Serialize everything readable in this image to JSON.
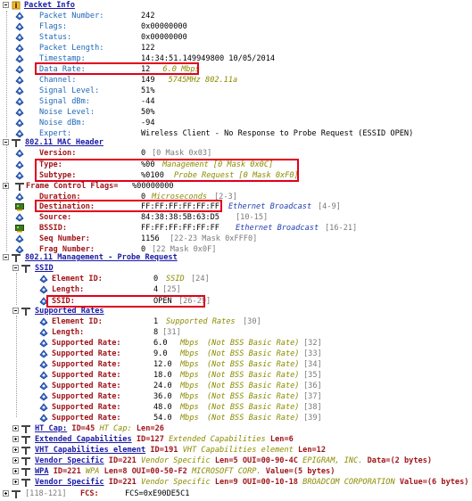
{
  "packet_info": {
    "title": "Packet Info",
    "fields": [
      {
        "label": "Packet Number:",
        "value": "242"
      },
      {
        "label": "Flags:",
        "value": "0x00000000"
      },
      {
        "label": "Status:",
        "value": "0x00000000"
      },
      {
        "label": "Packet Length:",
        "value": "122"
      },
      {
        "label": "Timestamp:",
        "value": "14:34:51.149949800 10/05/2014"
      },
      {
        "label": "Data Rate:",
        "value": "12",
        "extra": "6.0 Mbps"
      },
      {
        "label": "Channel:",
        "value": "149",
        "extra": "5745MHz  802.11a"
      },
      {
        "label": "Signal Level:",
        "value": "51%"
      },
      {
        "label": "Signal dBm:",
        "value": "-44"
      },
      {
        "label": "Noise Level:",
        "value": "50%"
      },
      {
        "label": "Noise dBm:",
        "value": "-94"
      },
      {
        "label": "Expert:",
        "value": "Wireless Client - No Response to Probe Request (ESSID OPEN)"
      }
    ]
  },
  "mac_header": {
    "title": "802.11 MAC Header",
    "version": {
      "label": "Version:",
      "value": "0",
      "extra": "[0 Mask 0x03]"
    },
    "type": {
      "label": "Type:",
      "value": "%00",
      "extra": "Management [0 Mask 0x0C]"
    },
    "subtype": {
      "label": "Subtype:",
      "value": "%0100",
      "extra": "Probe Request [0 Mask 0xF0]"
    },
    "fcf": {
      "label": "Frame Control Flags=",
      "value": "%00000000"
    },
    "duration": {
      "label": "Duration:",
      "value": "0",
      "extra": "Microseconds",
      "range": "[2-3]"
    },
    "destination": {
      "label": "Destination:",
      "value": "FF:FF:FF:FF:FF:FF",
      "extra": "Ethernet Broadcast",
      "range": "[4-9]"
    },
    "source": {
      "label": "Source:",
      "value": "84:38:38:5B:63:D5",
      "range": "[10-15]"
    },
    "bssid": {
      "label": "BSSID:",
      "value": "FF:FF:FF:FF:FF:FF",
      "extra": "Ethernet Broadcast",
      "range": "[16-21]"
    },
    "seq": {
      "label": "Seq Number:",
      "value": "1156",
      "extra": "[22-23 Mask 0xFFF0]"
    },
    "frag": {
      "label": "Frag Number:",
      "value": "0",
      "extra": "[22 Mask 0x0F]"
    }
  },
  "mgmt": {
    "title": "802.11 Management - Probe Request",
    "ssid": {
      "title": "SSID",
      "element_id": {
        "label": "Element ID:",
        "value": "0",
        "extra": "SSID",
        "range": "[24]"
      },
      "length": {
        "label": "Length:",
        "value": "4",
        "range": "[25]"
      },
      "ssid": {
        "label": "SSID:",
        "value": "OPEN",
        "range": "[26-29]"
      }
    },
    "rates": {
      "title": "Supported Rates",
      "element_id": {
        "label": "Element ID:",
        "value": "1",
        "extra": "Supported Rates",
        "range": "[30]"
      },
      "length": {
        "label": "Length:",
        "value": "8",
        "range": "[31]"
      },
      "items": [
        {
          "label": "Supported Rate:",
          "value": "6.0",
          "unit": "Mbps",
          "note": "(Not BSS Basic Rate)",
          "range": "[32]"
        },
        {
          "label": "Supported Rate:",
          "value": "9.0",
          "unit": "Mbps",
          "note": "(Not BSS Basic Rate)",
          "range": "[33]"
        },
        {
          "label": "Supported Rate:",
          "value": "12.0",
          "unit": "Mbps",
          "note": "(Not BSS Basic Rate)",
          "range": "[34]"
        },
        {
          "label": "Supported Rate:",
          "value": "18.0",
          "unit": "Mbps",
          "note": "(Not BSS Basic Rate)",
          "range": "[35]"
        },
        {
          "label": "Supported Rate:",
          "value": "24.0",
          "unit": "Mbps",
          "note": "(Not BSS Basic Rate)",
          "range": "[36]"
        },
        {
          "label": "Supported Rate:",
          "value": "36.0",
          "unit": "Mbps",
          "note": "(Not BSS Basic Rate)",
          "range": "[37]"
        },
        {
          "label": "Supported Rate:",
          "value": "48.0",
          "unit": "Mbps",
          "note": "(Not BSS Basic Rate)",
          "range": "[38]"
        },
        {
          "label": "Supported Rate:",
          "value": "54.0",
          "unit": "Mbps",
          "note": "(Not BSS Basic Rate)",
          "range": "[39]"
        }
      ]
    },
    "collapsed": [
      {
        "link": "HT Cap:",
        "p1": "ID=45",
        "i1": "HT Cap:",
        "p2": "Len=26"
      },
      {
        "link": "Extended Capabilities",
        "p1": "ID=127",
        "i1": "Extended Capabilities",
        "p2": "Len=6"
      },
      {
        "link": "VHT Capabilities element",
        "p1": "ID=191",
        "i1": "VHT Capabilities element",
        "p2": "Len=12"
      },
      {
        "link": "Vendor Specific",
        "p1": "ID=221",
        "i1": "Vendor Specific",
        "p2": "Len=5 OUI=00-90-4C",
        "i2": "EPIGRAM, INC.",
        "p3": "Data=(2 bytes)"
      },
      {
        "link": "WPA",
        "p1": "ID=221",
        "i1": "WPA",
        "p2": "Len=8 OUI=00-50-F2",
        "i2": "MICROSOFT CORP.",
        "p3": "Value=(5 bytes)"
      },
      {
        "link": "Vendor Specific",
        "p1": "ID=221",
        "i1": "Vendor Specific",
        "p2": "Len=9 OUI=00-10-18",
        "i2": "BROADCOM CORPORATION",
        "p3": "Value=(6 bytes)"
      }
    ]
  },
  "fcs": {
    "range": "[118-121]",
    "label": "FCS:",
    "value": "FCS=0xE90DE5C1"
  }
}
